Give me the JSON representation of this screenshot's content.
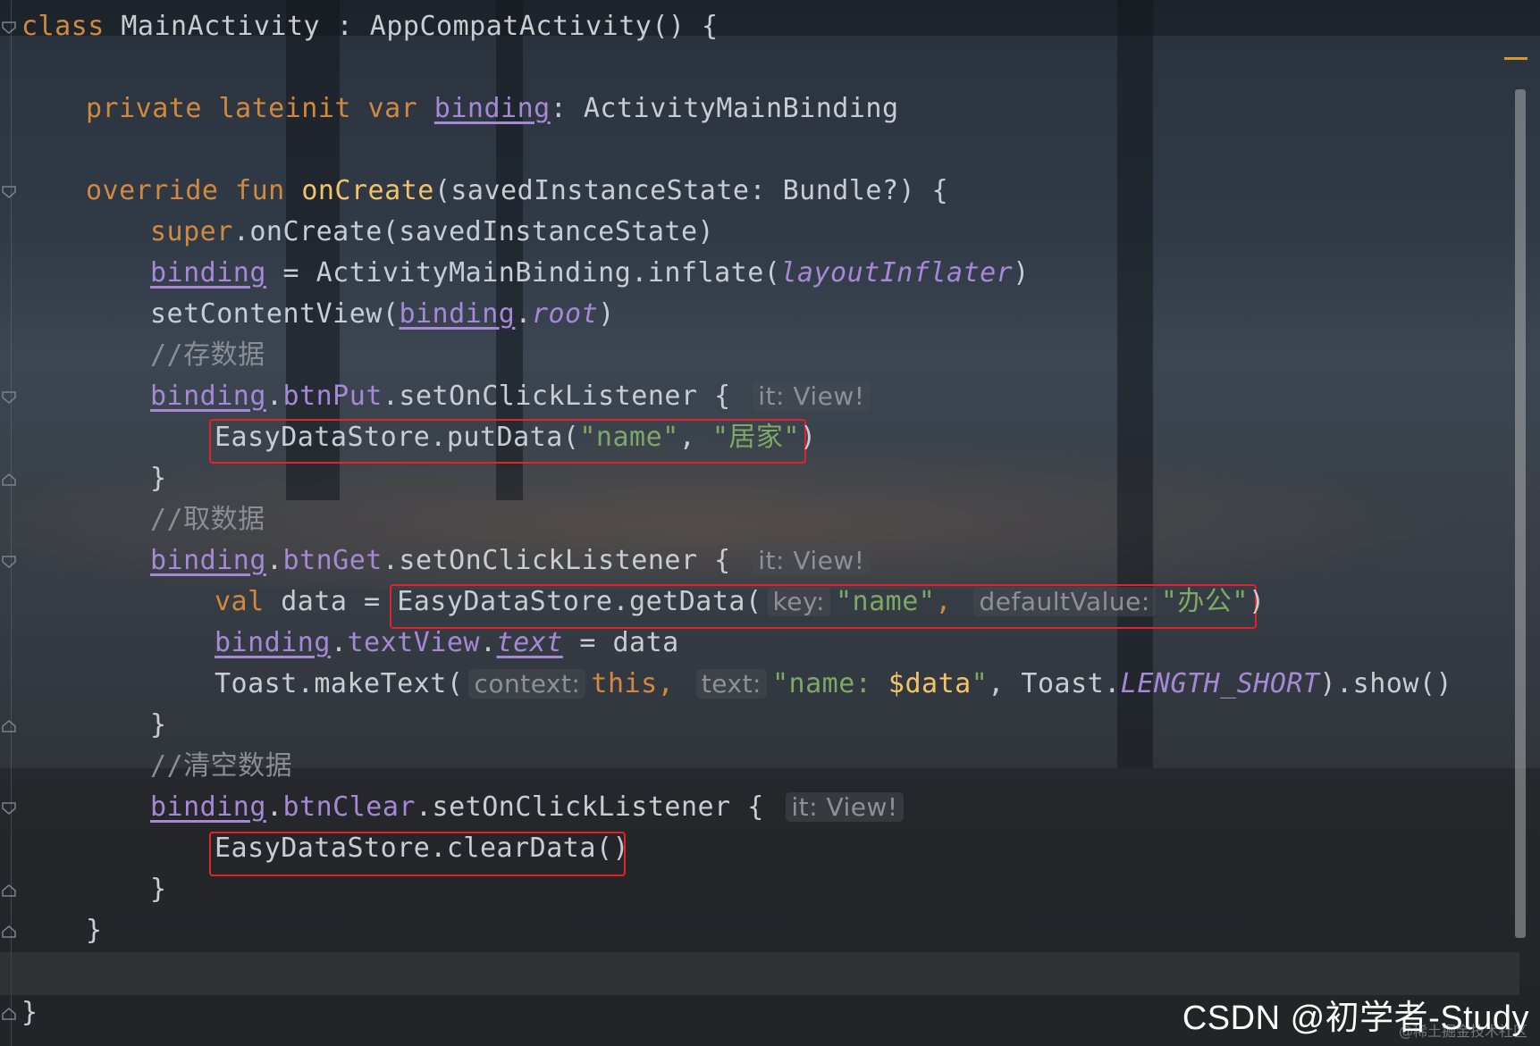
{
  "code": {
    "l1_kw": "class",
    "l1_rest": " MainActivity : AppCompatActivity() {",
    "l2_kw": "private lateinit var",
    "l2_prop": "binding",
    "l2_rest": ": ActivityMainBinding",
    "l3_kw": "override fun",
    "l3_fn": "onCreate",
    "l3_rest": "(savedInstanceState: Bundle?) {",
    "l4_kw": "super",
    "l4_rest": ".onCreate(savedInstanceState)",
    "l5_prop": "binding",
    "l5_rest": " = ActivityMainBinding.inflate(",
    "l5_it": "layoutInflater",
    "l5_end": ")",
    "l6_start": "setContentView(",
    "l6_prop": "binding",
    "l6_dot": ".",
    "l6_it": "root",
    "l6_end": ")",
    "c1": "//存数据",
    "l7_prop": "binding",
    "l7_dot": ".",
    "l7_btn": "btnPut",
    "l7_rest": ".setOnClickListener {",
    "hint_it": "it: View!",
    "l8_start": "EasyDataStore.putData(",
    "l8_s1": "\"name\"",
    "l8_comma": ", ",
    "l8_s2": "\"居家\"",
    "l8_end": ")",
    "close_brace": "}",
    "c2": "//取数据",
    "l9_btn": "btnGet",
    "l10_kw": "val",
    "l10_mid": " data = ",
    "l10_call": "EasyDataStore.getData(",
    "hint_key": "key:",
    "l10_s1": "\"name\"",
    "l10_comma": ",",
    "hint_default": "defaultValue:",
    "l10_s2": "\"办公\"",
    "l10_end": ")",
    "l11_textview": "textView",
    "l11_text": "text",
    "l11_rest": " = data",
    "l12_start": "Toast.makeText(",
    "hint_context": "context:",
    "l12_this": "this",
    "hint_text": "text:",
    "l12_str1": "\"name: ",
    "l12_var": "$data",
    "l12_str2": "\"",
    "l12_mid": ", Toast.",
    "l12_const": "LENGTH_SHORT",
    "l12_end": ").show()",
    "c3": "//清空数据",
    "l13_btn": "btnClear",
    "l14": "EasyDataStore.clearData()"
  },
  "watermark": {
    "main": "CSDN @初学者-Study",
    "sub": "@稀土掘金技术社区"
  },
  "colors": {
    "keyword": "#d1893f",
    "function": "#f2c46a",
    "property": "#a788d6",
    "string": "#7ea866",
    "comment": "#8a8e94",
    "highlight_box": "#e0242a"
  }
}
